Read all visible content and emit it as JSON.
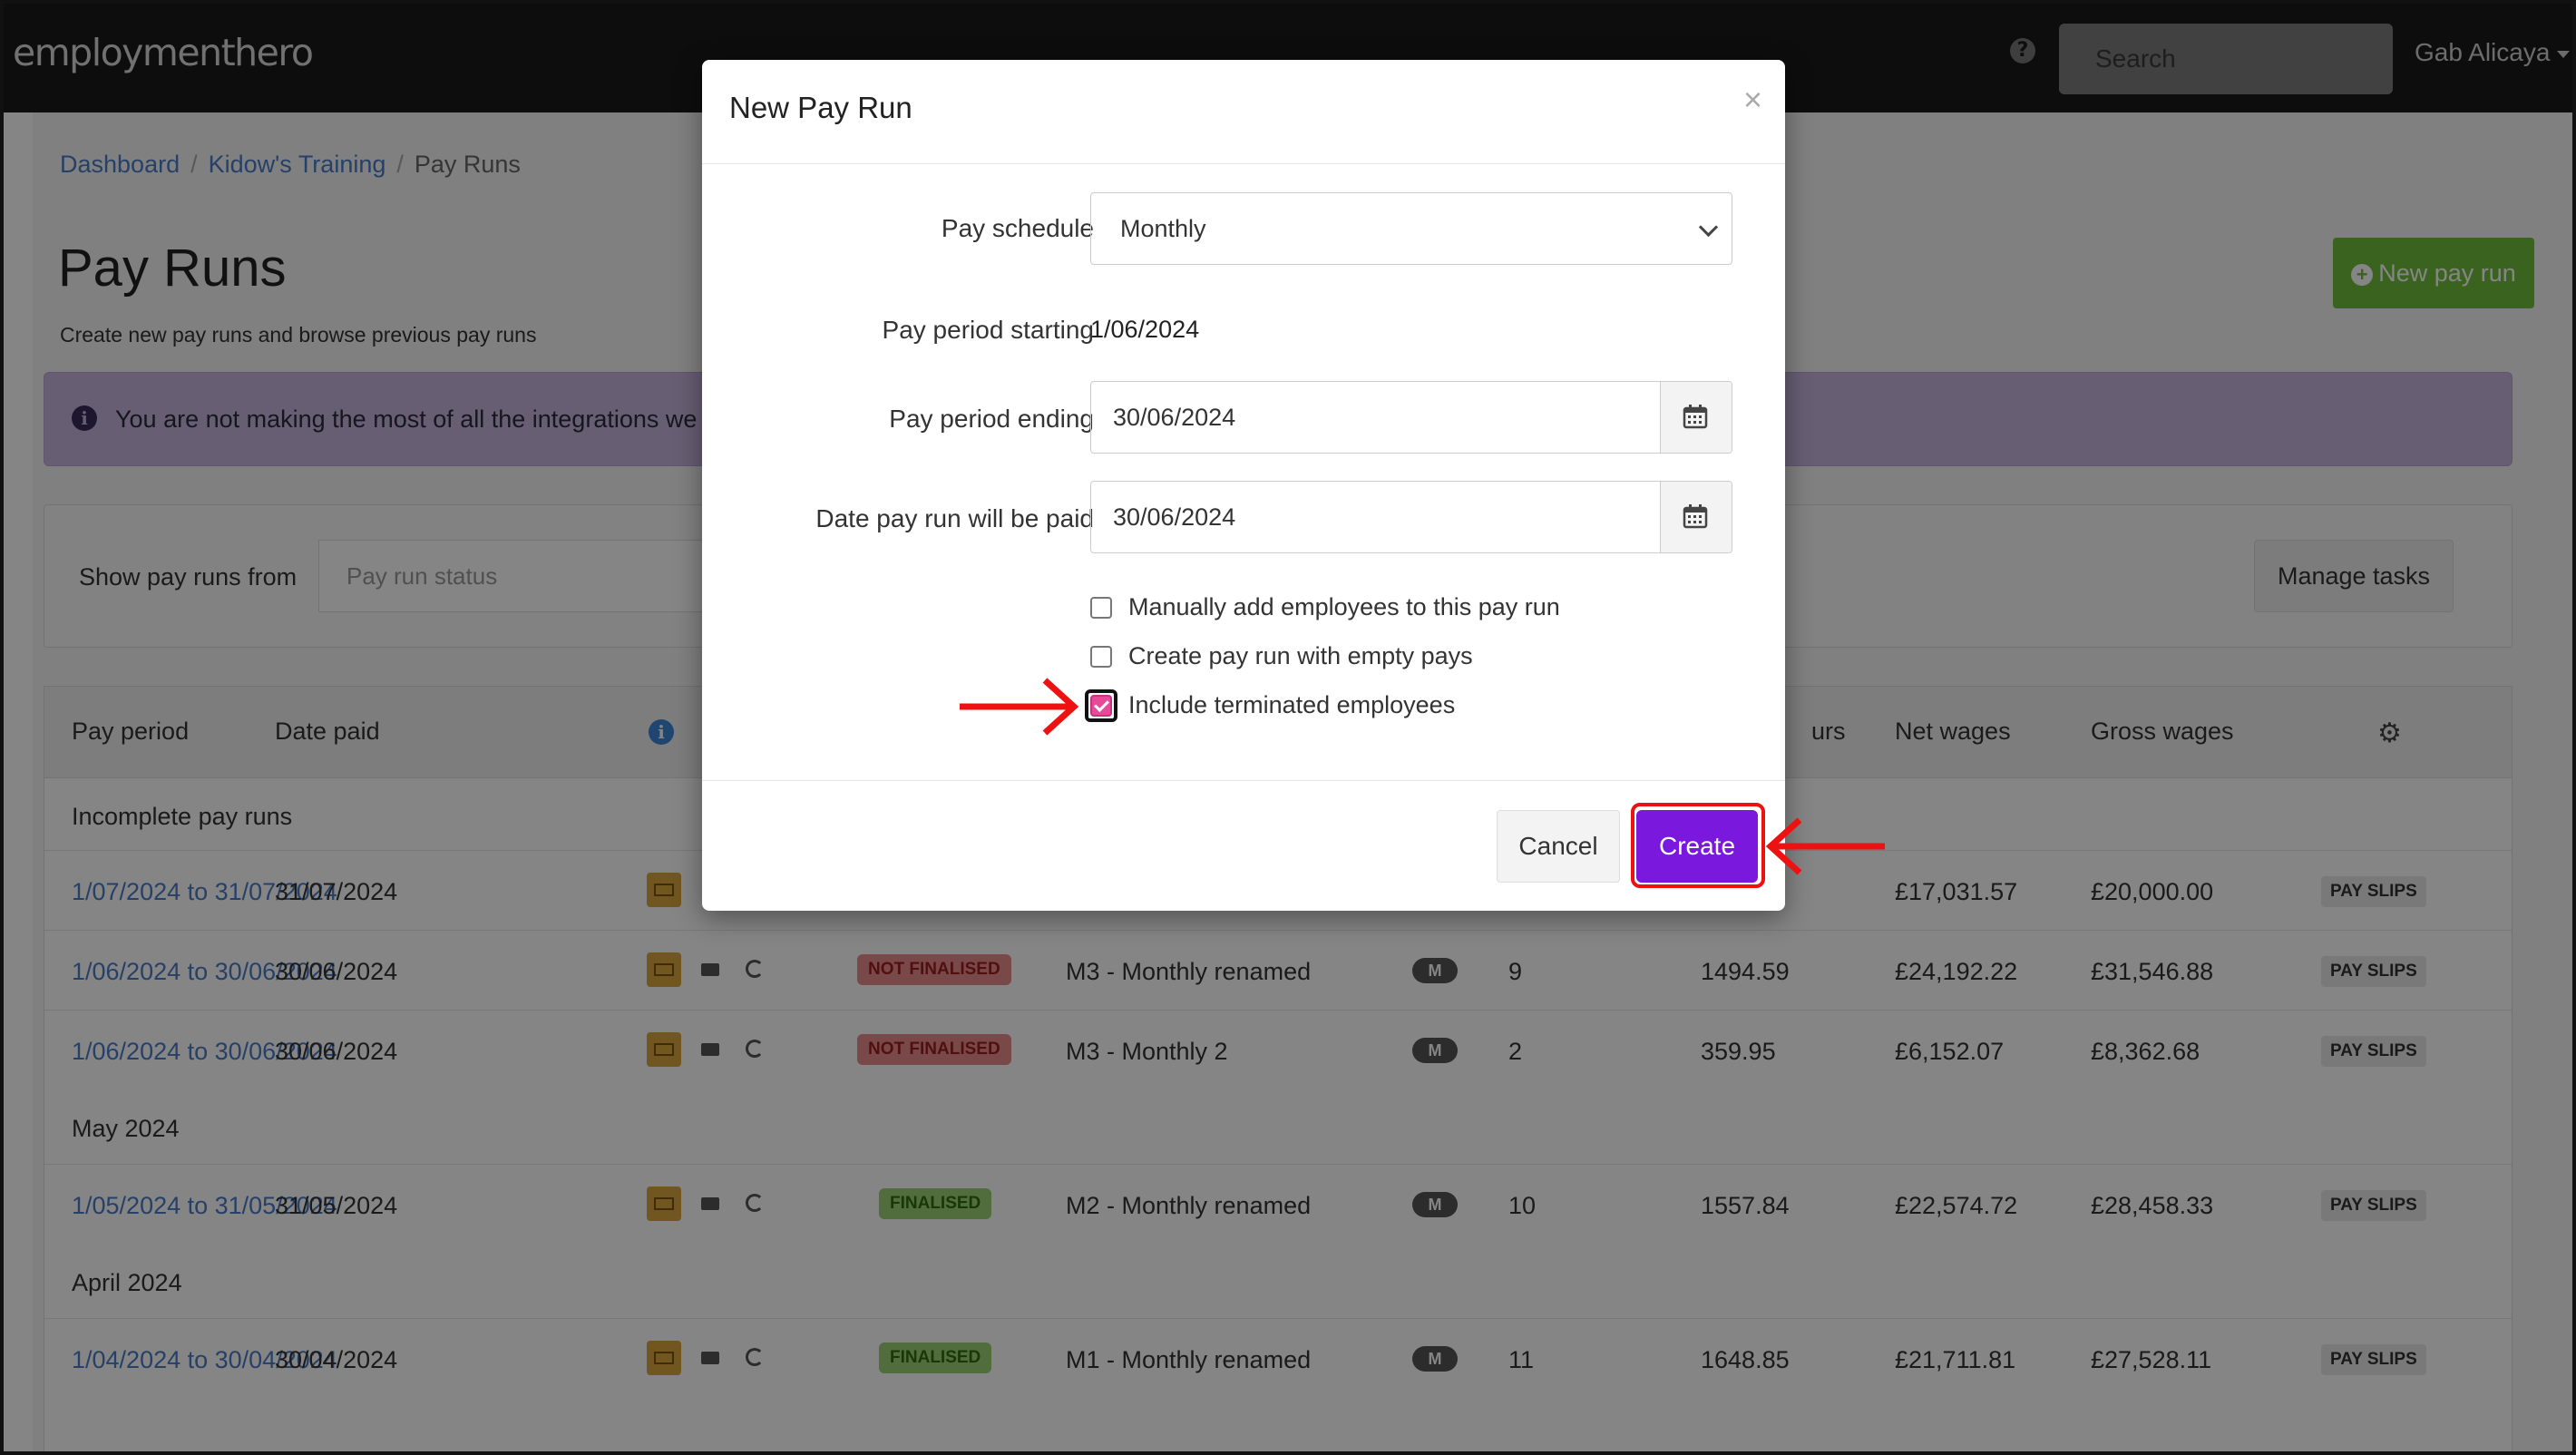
{
  "topbar": {
    "logo": "employmenthero",
    "search_placeholder": "Search",
    "user_name": "Gab Alicaya"
  },
  "breadcrumb": {
    "items": [
      "Dashboard",
      "Kidow's Training",
      "Pay Runs"
    ]
  },
  "page": {
    "title": "Pay Runs",
    "subtitle": "Create new pay runs and browse previous pay runs",
    "new_button": "New pay run",
    "alert": "You are not making the most of all the integrations we",
    "filter_label": "Show pay runs from",
    "status_placeholder": "Pay run status",
    "manage_tasks": "Manage tasks"
  },
  "table": {
    "headers": {
      "pay_period": "Pay period",
      "date_paid": "Date paid",
      "hours": "urs",
      "net": "Net wages",
      "gross": "Gross wages"
    },
    "groups": [
      "Incomplete pay runs",
      "May 2024",
      "April 2024"
    ],
    "rows": [
      {
        "period": "1/07/2024 to 31/07/2024",
        "date": "31/07/2024",
        "status": "",
        "schedule": "",
        "m": "",
        "count": "",
        "hours": "",
        "net": "£17,031.57",
        "gross": "£20,000.00",
        "slips": "PAY SLIPS"
      },
      {
        "period": "1/06/2024 to 30/06/2024",
        "date": "30/06/2024",
        "status": "NOT FINALISED",
        "schedule": "M3 - Monthly renamed",
        "m": "M",
        "count": "9",
        "hours": "1494.59",
        "net": "£24,192.22",
        "gross": "£31,546.88",
        "slips": "PAY SLIPS"
      },
      {
        "period": "1/06/2024 to 30/06/2024",
        "date": "30/06/2024",
        "status": "NOT FINALISED",
        "schedule": "M3 - Monthly 2",
        "m": "M",
        "count": "2",
        "hours": "359.95",
        "net": "£6,152.07",
        "gross": "£8,362.68",
        "slips": "PAY SLIPS"
      },
      {
        "period": "1/05/2024 to 31/05/2024",
        "date": "31/05/2024",
        "status": "FINALISED",
        "schedule": "M2 - Monthly renamed",
        "m": "M",
        "count": "10",
        "hours": "1557.84",
        "net": "£22,574.72",
        "gross": "£28,458.33",
        "slips": "PAY SLIPS"
      },
      {
        "period": "1/04/2024 to 30/04/2024",
        "date": "30/04/2024",
        "status": "FINALISED",
        "schedule": "M1 - Monthly renamed",
        "m": "M",
        "count": "11",
        "hours": "1648.85",
        "net": "£21,711.81",
        "gross": "£27,528.11",
        "slips": "PAY SLIPS"
      }
    ]
  },
  "modal": {
    "title": "New Pay Run",
    "close": "×",
    "pay_schedule_label": "Pay schedule",
    "pay_schedule_value": "Monthly",
    "period_start_label": "Pay period starting",
    "period_start_value": "1/06/2024",
    "period_end_label": "Pay period ending",
    "period_end_value": "30/06/2024",
    "paid_date_label": "Date pay run will be paid",
    "paid_date_value": "30/06/2024",
    "options": [
      {
        "label": "Manually add employees to this pay run",
        "checked": false
      },
      {
        "label": "Create pay run with empty pays",
        "checked": false
      },
      {
        "label": "Include terminated employees",
        "checked": true
      }
    ],
    "cancel": "Cancel",
    "create": "Create"
  },
  "colors": {
    "create_button": "#7a18dd",
    "annotation": "#ee1111",
    "checkbox_checked": "#e84a9a",
    "new_button": "#6fbf3c"
  }
}
